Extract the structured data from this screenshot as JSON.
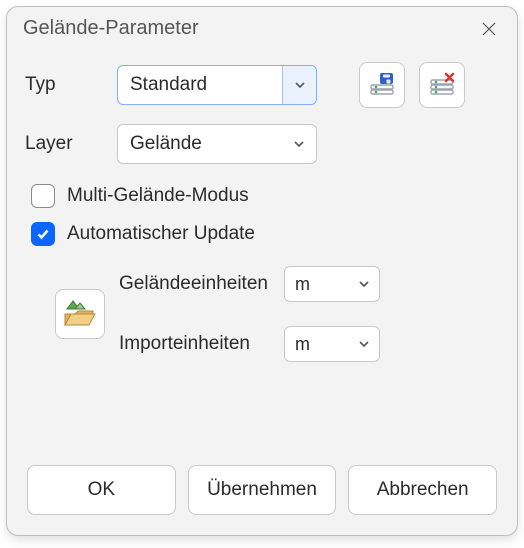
{
  "window": {
    "title": "Gelände-Parameter"
  },
  "form": {
    "typ_label": "Typ",
    "typ_value": "Standard",
    "layer_label": "Layer",
    "layer_value": "Gelände",
    "multi_mode_label": "Multi-Gelände-Modus",
    "multi_mode_checked": false,
    "auto_update_label": "Automatischer Update",
    "auto_update_checked": true,
    "terrain_units_label": "Geländeeinheiten",
    "terrain_units_value": "m",
    "import_units_label": "Importeinheiten",
    "import_units_value": "m"
  },
  "buttons": {
    "ok": "OK",
    "apply": "Übernehmen",
    "cancel": "Abbrechen"
  },
  "icons": {
    "save_db": "save-database-icon",
    "delete_db": "delete-database-icon",
    "terrain_folder": "terrain-folder-icon"
  }
}
